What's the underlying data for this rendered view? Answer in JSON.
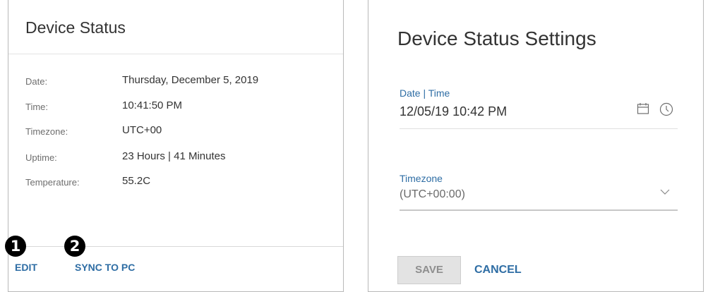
{
  "device_status": {
    "title": "Device Status",
    "rows": [
      {
        "label": "Date:",
        "value": "Thursday, December 5, 2019"
      },
      {
        "label": "Time:",
        "value": "10:41:50 PM"
      },
      {
        "label": "Timezone:",
        "value": "UTC+00"
      },
      {
        "label": "Uptime:",
        "value": "23 Hours | 41 Minutes"
      },
      {
        "label": "Temperature:",
        "value": "55.2C"
      }
    ],
    "callouts": [
      "1",
      "2"
    ],
    "edit_label": "EDIT",
    "sync_label": "SYNC TO PC"
  },
  "settings": {
    "title": "Device Status Settings",
    "datetime_label": "Date | Time",
    "datetime_value": "12/05/19 10:42 PM",
    "timezone_label": "Timezone",
    "timezone_value": "(UTC+00:00)",
    "save_label": "SAVE",
    "cancel_label": "CANCEL"
  },
  "icons": {
    "calendar": "calendar-icon",
    "clock": "clock-icon",
    "dropdown": "chevron-down-icon"
  },
  "colors": {
    "accent": "#2e6da4",
    "disabled_button_bg": "#e3e3e3",
    "disabled_button_text": "#8e8e8e"
  }
}
